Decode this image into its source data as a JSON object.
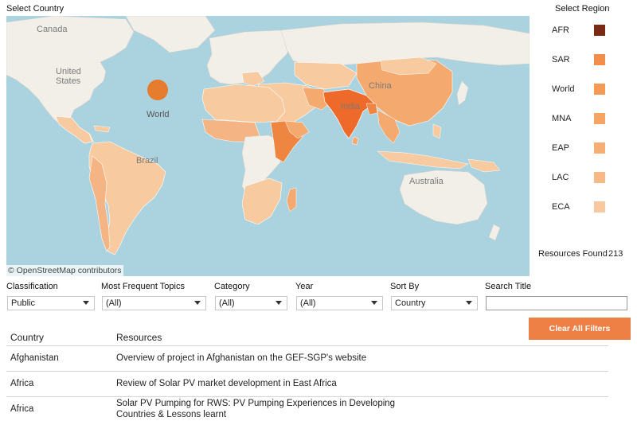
{
  "select_country_title": "Select Country",
  "select_region_title": "Select Region",
  "map": {
    "labels": {
      "canada": "Canada",
      "united_states": "United States",
      "world": "World",
      "brazil": "Brazil",
      "china": "China",
      "india": "India",
      "australia": "Australia"
    },
    "attribution": "© OpenStreetMap contributors",
    "colors": {
      "ocean": "#aad3df",
      "land": "#f2efe9",
      "tier_light": "#f7caa0",
      "tier_mid": "#f4a96e",
      "tier_strong": "#ee8540",
      "world_bubble": "#e67c2e"
    }
  },
  "legend": [
    {
      "label": "AFR",
      "color": "#7a2a12"
    },
    {
      "label": "SAR",
      "color": "#f28e4c"
    },
    {
      "label": "World",
      "color": "#f39a55"
    },
    {
      "label": "MNA",
      "color": "#f5a464"
    },
    {
      "label": "EAP",
      "color": "#f6ae74"
    },
    {
      "label": "LAC",
      "color": "#f7b986"
    },
    {
      "label": "ECA",
      "color": "#f8c8a0"
    }
  ],
  "resources_found": {
    "label": "Resources Found",
    "count": "213"
  },
  "filters": {
    "classification": {
      "label": "Classification",
      "value": "Public"
    },
    "topics": {
      "label": "Most Frequent Topics",
      "value": "(All)"
    },
    "category": {
      "label": "Category",
      "value": "(All)"
    },
    "year": {
      "label": "Year",
      "value": "(All)"
    },
    "sort_by": {
      "label": "Sort By",
      "value": "Country"
    },
    "search_title": {
      "label": "Search Title",
      "value": ""
    }
  },
  "clear_all_label": "Clear All Filters",
  "table": {
    "headers": {
      "country": "Country",
      "resources": "Resources"
    },
    "rows": [
      {
        "country": "Afghanistan",
        "resource_line1": "Overview of project in Afghanistan on the GEF-SGP's website",
        "resource_line2": ""
      },
      {
        "country": "Africa",
        "resource_line1": "Review of Solar PV market development in East Africa",
        "resource_line2": ""
      },
      {
        "country": "Africa",
        "resource_line1": "Solar PV Pumping for RWS: PV Pumping Experiences in Developing",
        "resource_line2": "Countries & Lessons learnt"
      }
    ]
  }
}
